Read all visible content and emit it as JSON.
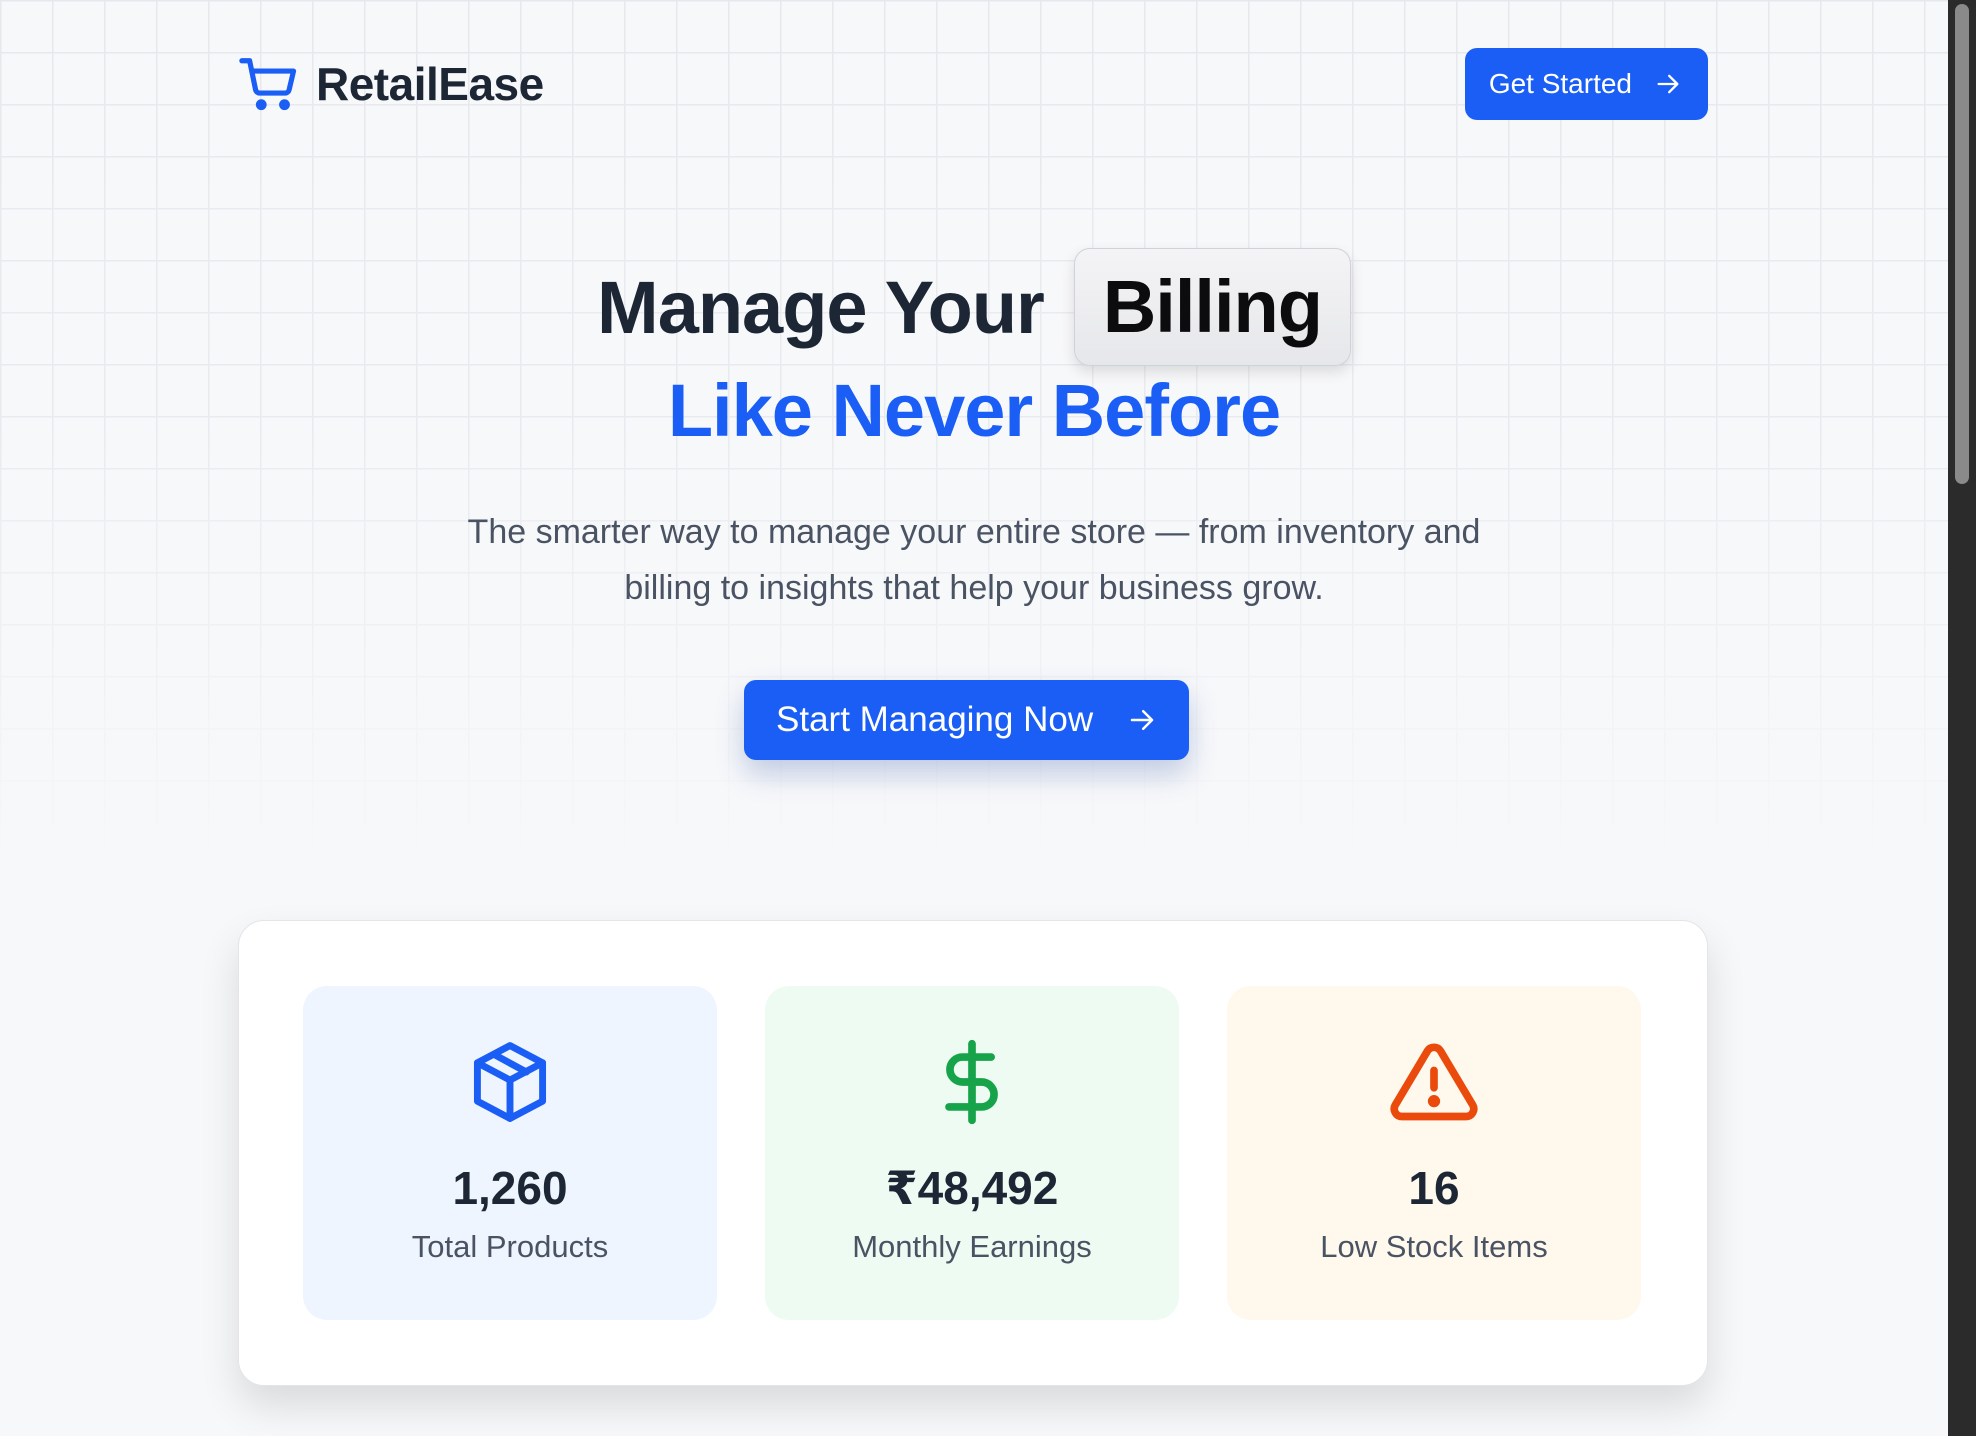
{
  "brand": {
    "name": "RetailEase",
    "icon": "shopping-cart-icon",
    "accent": "#1a5ef5"
  },
  "nav": {
    "cta_label": "Get Started",
    "cta_icon": "arrow-right-icon"
  },
  "hero": {
    "title_prefix": "Manage Your",
    "rotating_word": "Billing",
    "title_highlight": "Like Never Before",
    "description": "The smarter way to manage your entire store — from inventory and billing to insights that help your business grow.",
    "cta_label": "Start Managing Now",
    "cta_icon": "arrow-right-icon"
  },
  "stats": [
    {
      "icon": "box-icon",
      "value": "1,260",
      "label": "Total Products",
      "color": "#1a5ef5"
    },
    {
      "icon": "dollar-icon",
      "value": "₹48,492",
      "label": "Monthly Earnings",
      "color": "#16a34a"
    },
    {
      "icon": "warning-icon",
      "value": "16",
      "label": "Low Stock Items",
      "color": "#ea4a0c"
    }
  ]
}
